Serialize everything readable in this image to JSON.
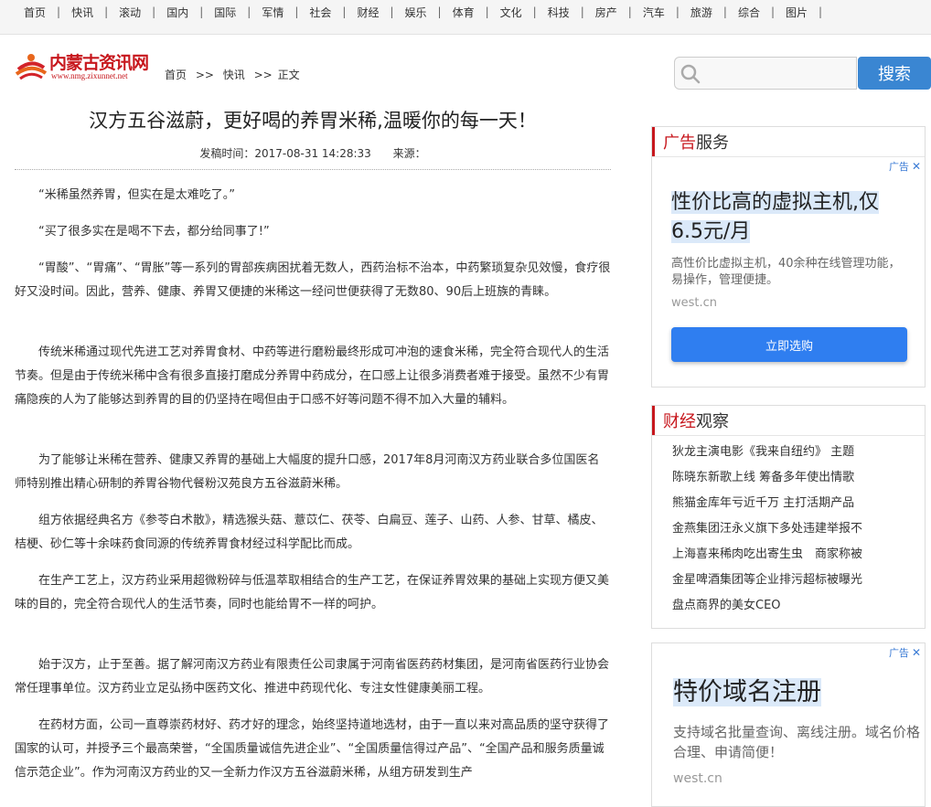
{
  "nav": {
    "items": [
      "首页",
      "快讯",
      "滚动",
      "国内",
      "国际",
      "军情",
      "社会",
      "财经",
      "娱乐",
      "体育",
      "文化",
      "科技",
      "房产",
      "汽车",
      "旅游",
      "综合",
      "图片"
    ],
    "separator": "|"
  },
  "logo": {
    "name": "内蒙古资讯网",
    "url": "www.nmg.zixunnet.net"
  },
  "breadcrumb": {
    "home": "首页",
    "arrow1": ">>",
    "section": "快讯",
    "arrow2": ">>",
    "current": "正文"
  },
  "search": {
    "placeholder": "",
    "button": "搜索"
  },
  "article": {
    "title": "汉方五谷滋蔚，更好喝的养胃米稀,温暖你的每一天！",
    "publish_time": "发稿时间：2017-08-31 14:28:33",
    "source": "来源：",
    "paragraphs": [
      "“米稀虽然养胃，但实在是太难吃了。”",
      "“买了很多实在是喝不下去，都分给同事了!”",
      "“胃酸”、“胃痛”、“胃胀”等一系列的胃部疾病困扰着无数人，西药治标不治本，中药繁琐复杂见效慢，食疗很好又没时间。因此，营养、健康、养胃又便捷的米稀这一经问世便获得了无数80、90后上班族的青睐。",
      "传统米稀通过现代先进工艺对养胃食材、中药等进行磨粉最终形成可冲泡的速食米稀，完全符合现代人的生活节奏。但是由于传统米稀中含有很多直接打磨成分养胃中药成分，在口感上让很多消费者难于接受。虽然不少有胃痛隐疾的人为了能够达到养胃的目的仍坚持在喝但由于口感不好等问题不得不加入大量的辅料。",
      "为了能够让米稀在营养、健康又养胃的基础上大幅度的提升口感，2017年8月河南汉方药业联合多位国医名师特别推出精心研制的养胃谷物代餐粉汉苑良方五谷滋蔚米稀。",
      "组方依据经典名方《参苓白术散》，精选猴头菇、薏苡仁、茯苓、白扁豆、莲子、山药、人参、甘草、橘皮、桔梗、砂仁等十余味药食同源的传统养胃食材经过科学配比而成。",
      "在生产工艺上，汉方药业采用超微粉碎与低温萃取相结合的生产工艺，在保证养胃效果的基础上实现方便又美味的目的，完全符合现代人的生活节奏，同时也能给胃不一样的呵护。",
      "始于汉方，止于至善。据了解河南汉方药业有限责任公司隶属于河南省医药药材集团，是河南省医药行业协会常任理事单位。汉方药业立足弘扬中医药文化、推进中药现代化、专注女性健康美丽工程。",
      "在药材方面，公司一直尊崇药材好、药才好的理念，始终坚持道地选材，由于一直以来对高品质的坚守获得了国家的认可，并授予三个最高荣誉，“全国质量诚信先进企业”、“全国质量信得过产品”、“全国产品和服务质量诚信示范企业”。作为河南汉方药业的又一全新力作汉方五谷滋蔚米稀，从组方研发到生产"
    ]
  },
  "sidebar": {
    "ad_service": {
      "title_red": "广告",
      "title_black": "服务"
    },
    "ad1": {
      "badge": "广告",
      "title": "性价比高的虚拟主机,仅6.5元/月",
      "desc": "高性价比虚拟主机，40余种在线管理功能，易操作，管理便捷。",
      "host": "west.cn",
      "cta": "立即选购"
    },
    "finance": {
      "title_red": "财经",
      "title_black": "观察",
      "items": [
        "狄龙主演电影《我来自纽约》 主题",
        "陈晓东新歌上线 筹备多年使出情歌",
        "熊猫金库年亏近千万 主打活期产品",
        "金燕集团汪永义旗下多处违建举报不",
        "上海喜来稀肉吃出寄生虫　商家称被",
        "金星啤酒集团等企业排污超标被曝光",
        "盘点商界的美女CEO"
      ]
    },
    "ad2": {
      "badge": "广告",
      "title": "特价域名注册",
      "desc": "支持域名批量查询、离线注册。域名价格合理、申请简便！",
      "host": "west.cn"
    }
  }
}
